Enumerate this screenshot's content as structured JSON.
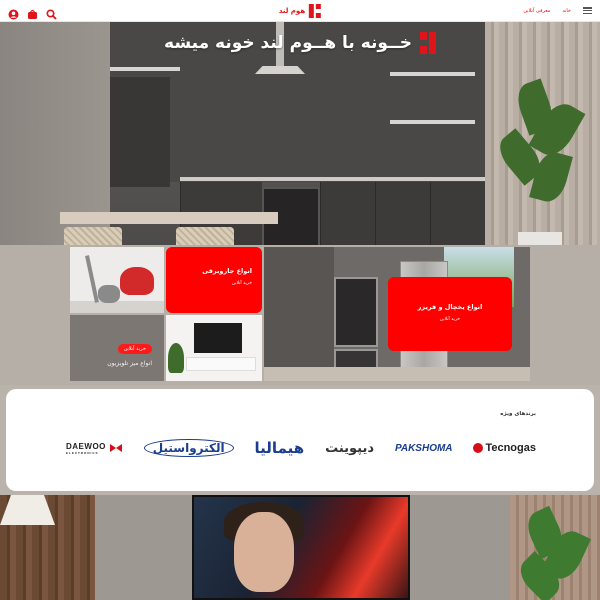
{
  "header": {
    "brand": "هوم لند",
    "nav": [
      "خانه",
      "معرفی آنلاین"
    ],
    "icons": [
      "menu-icon",
      "search-icon",
      "cart-icon",
      "user-icon"
    ]
  },
  "hero": {
    "headline": "خــونه با هــوم لند خونه میشه"
  },
  "categories": {
    "vacuum": {
      "title": "انواع جاروبرقی",
      "cta": "خرید آنلاین"
    },
    "fridge": {
      "title": "انواع یخچال و فریزر",
      "cta": "خرید آنلاین"
    },
    "tv_stand": {
      "pill": "خرید آنلاین",
      "title": "انواع میز تلویزیون"
    }
  },
  "brands": {
    "title": "برندهای ویژه",
    "items": [
      {
        "name": "Tecnogas"
      },
      {
        "name": "PAKSHOMA"
      },
      {
        "name": "دیپوینت"
      },
      {
        "name": "هیمالیا"
      },
      {
        "name": "الکترواستیل"
      },
      {
        "name": "DAEWOO",
        "sub": "ELECTRONICS"
      }
    ]
  },
  "colors": {
    "accent": "#ff0000",
    "brand_red": "#e0141b"
  }
}
